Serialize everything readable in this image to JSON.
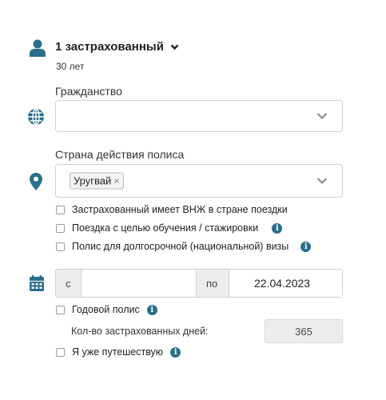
{
  "insured": {
    "title": "1 застрахованный",
    "age": "30 лет"
  },
  "citizenship": {
    "label": "Гражданство",
    "value": ""
  },
  "policy_country": {
    "label": "Страна действия полиса",
    "tag": "Уругвай",
    "tag_remove": "×"
  },
  "checkboxes": {
    "residence": "Застрахованный имеет ВНЖ в стране поездки",
    "study": "Поездка с целью обучения / стажировки",
    "long_term": "Полис для долгосрочной (национальной) визы"
  },
  "dates": {
    "from_label": "с",
    "from_value": "",
    "to_label": "по",
    "to_value": "22.04.2023"
  },
  "annual": {
    "label": "Годовой полис"
  },
  "days": {
    "label": "Кол-во застрахованных дней:",
    "value": "365"
  },
  "traveling": {
    "label": "Я уже путешествую"
  },
  "icons": {
    "person": "person-icon",
    "globe": "globe-icon",
    "location": "map-pin-icon",
    "calendar": "calendar-icon",
    "info": "info-icon",
    "chevron": "chevron-down-icon"
  },
  "colors": {
    "accent": "#2a6e8c"
  }
}
